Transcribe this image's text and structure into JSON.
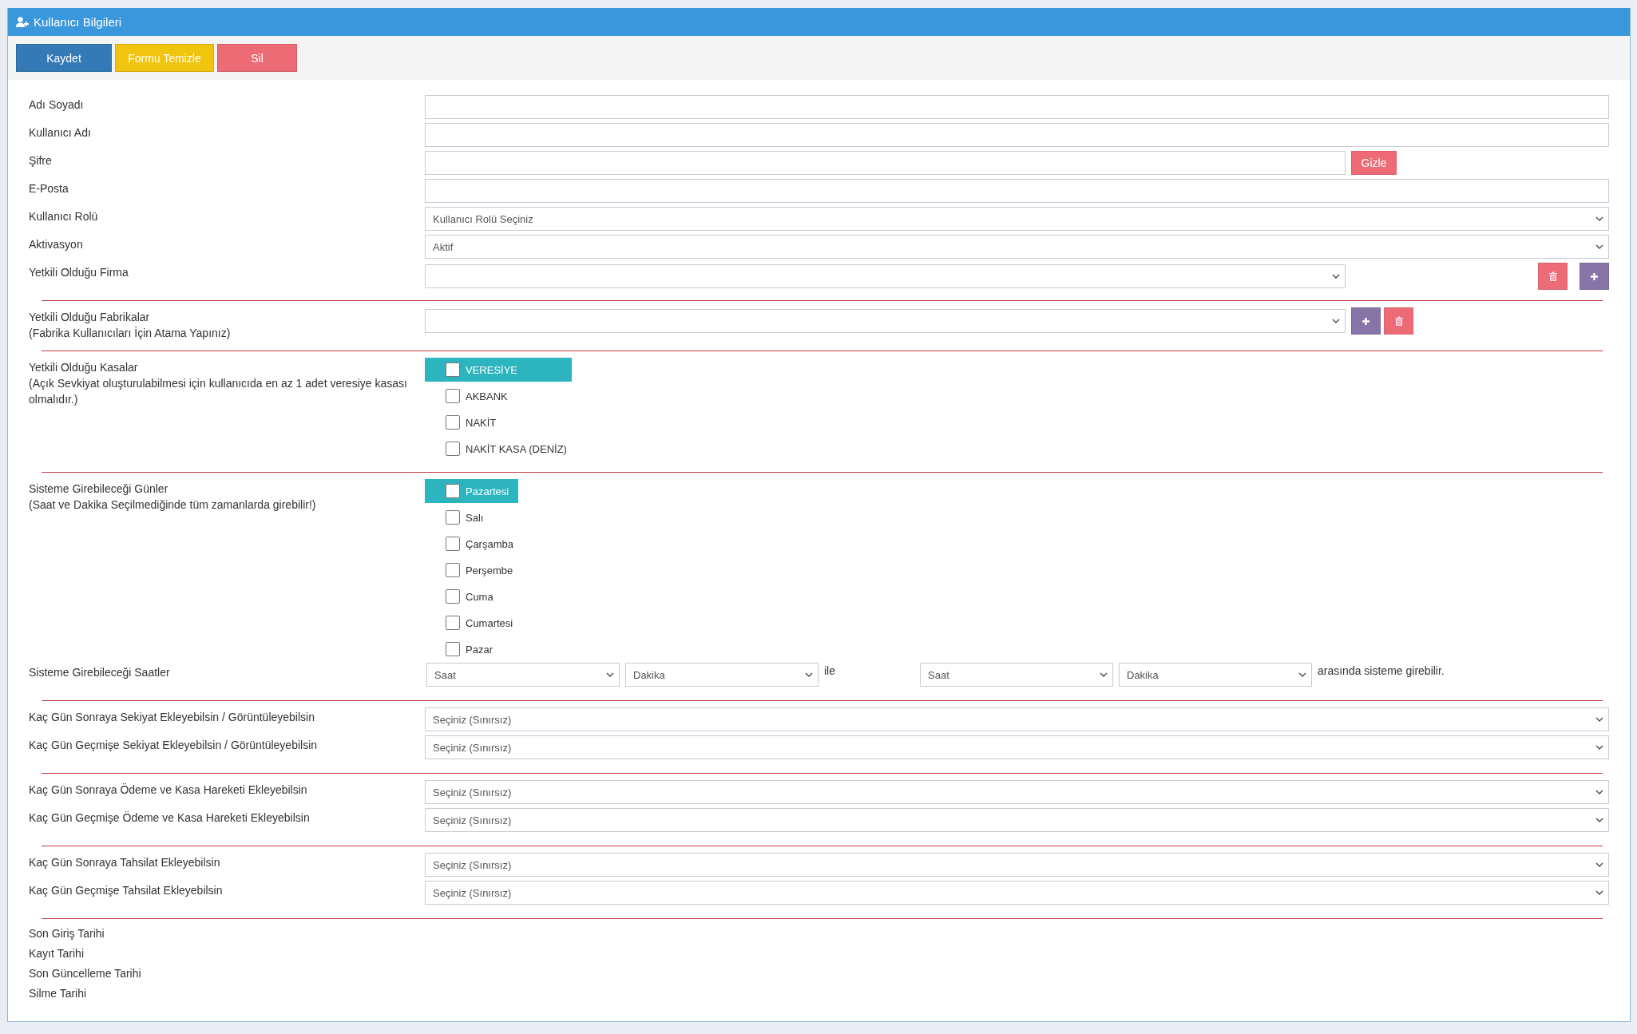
{
  "panel": {
    "title": "Kullanıcı Bilgileri"
  },
  "toolbar": [
    {
      "label": "Kaydet",
      "kind": "primary"
    },
    {
      "label": "Formu Temizle",
      "kind": "warning"
    },
    {
      "label": "Sil",
      "kind": "danger"
    }
  ],
  "sections": [
    {
      "rows": [
        {
          "kind": "text",
          "label": "Adı Soyadı"
        },
        {
          "kind": "text",
          "label": "Kullanıcı Adı"
        },
        {
          "kind": "password",
          "label": "Şifre",
          "button": "Gizle"
        },
        {
          "kind": "text",
          "label": "E-Posta"
        },
        {
          "kind": "select",
          "label": "Kullanıcı Rolü",
          "value": "Kullanıcı Rolü Seçiniz"
        },
        {
          "kind": "select",
          "label": "Aktivasyon",
          "value": "Aktif"
        },
        {
          "kind": "select-actions-end",
          "label": "Yetkili Olduğu Firma",
          "actions": [
            {
              "kind": "delete"
            },
            {
              "kind": "add"
            }
          ]
        }
      ]
    },
    {
      "rows": [
        {
          "kind": "select-actions",
          "label": "Yetkili Olduğu Fabrikalar",
          "note": "(Fabrika Kullanıcıları İçin Atama Yapınız)",
          "actions": [
            {
              "kind": "add"
            },
            {
              "kind": "delete"
            }
          ]
        }
      ]
    },
    {
      "rows": [
        {
          "kind": "checklist",
          "label": "Yetkili Olduğu Kasalar",
          "note": "(Açık Sevkiyat oluşturulabilmesi için kullanıcıda en az 1 adet veresiye kasası olmalıdır.)",
          "items": [
            {
              "label": "VERESİYE",
              "checked": false,
              "highlighted": true
            },
            {
              "label": "AKBANK",
              "checked": false,
              "highlighted": false
            },
            {
              "label": "NAKİT",
              "checked": false,
              "highlighted": false
            },
            {
              "label": "NAKİT KASA (DENİZ)",
              "checked": false,
              "highlighted": false
            }
          ]
        }
      ]
    },
    {
      "rows": [
        {
          "kind": "checklist",
          "label": "Sisteme Girebileceği Günler",
          "note": "(Saat ve Dakika Seçilmediğinde tüm zamanlarda girebilir!)",
          "items": [
            {
              "label": "Pazartesi",
              "checked": false,
              "highlighted": true
            },
            {
              "label": "Salı",
              "checked": false,
              "highlighted": false
            },
            {
              "label": "Çarşamba",
              "checked": false,
              "highlighted": false
            },
            {
              "label": "Perşembe",
              "checked": false,
              "highlighted": false
            },
            {
              "label": "Cuma",
              "checked": false,
              "highlighted": false
            },
            {
              "label": "Cumartesi",
              "checked": false,
              "highlighted": false
            },
            {
              "label": "Pazar",
              "checked": false,
              "highlighted": false
            }
          ]
        },
        {
          "kind": "time-range",
          "label": "Sisteme Girebileceği Saatler",
          "from": [
            "Saat",
            "Dakika"
          ],
          "joiner": "ile",
          "to": [
            "Saat",
            "Dakika"
          ],
          "suffix": "arasında sisteme girebilir."
        }
      ]
    },
    {
      "rows": [
        {
          "kind": "select",
          "label": "Kaç Gün Sonraya Sekiyat Ekleyebilsin / Görüntüleyebilsin",
          "value": "Seçiniz (Sınırsız)"
        },
        {
          "kind": "select",
          "label": "Kaç Gün Geçmişe Sekiyat Ekleyebilsin / Görüntüleyebilsin",
          "value": "Seçiniz (Sınırsız)"
        }
      ]
    },
    {
      "rows": [
        {
          "kind": "select",
          "label": "Kaç Gün Sonraya Ödeme ve Kasa Hareketi Ekleyebilsin",
          "value": "Seçiniz (Sınırsız)"
        },
        {
          "kind": "select",
          "label": "Kaç Gün Geçmişe Ödeme ve Kasa Hareketi Ekleyebilsin",
          "value": "Seçiniz (Sınırsız)"
        }
      ]
    },
    {
      "rows": [
        {
          "kind": "select",
          "label": "Kaç Gün Sonraya Tahsilat Ekleyebilsin",
          "value": "Seçiniz (Sınırsız)"
        },
        {
          "kind": "select",
          "label": "Kaç Gün Geçmişe Tahsilat Ekleyebilsin",
          "value": "Seçiniz (Sınırsız)"
        }
      ]
    },
    {
      "rows": [
        {
          "kind": "info",
          "label": "Son Giriş Tarihi"
        },
        {
          "kind": "info",
          "label": "Kayıt Tarihi"
        },
        {
          "kind": "info",
          "label": "Son Güncelleme Tarihi"
        },
        {
          "kind": "info",
          "label": "Silme Tarihi"
        }
      ]
    }
  ]
}
